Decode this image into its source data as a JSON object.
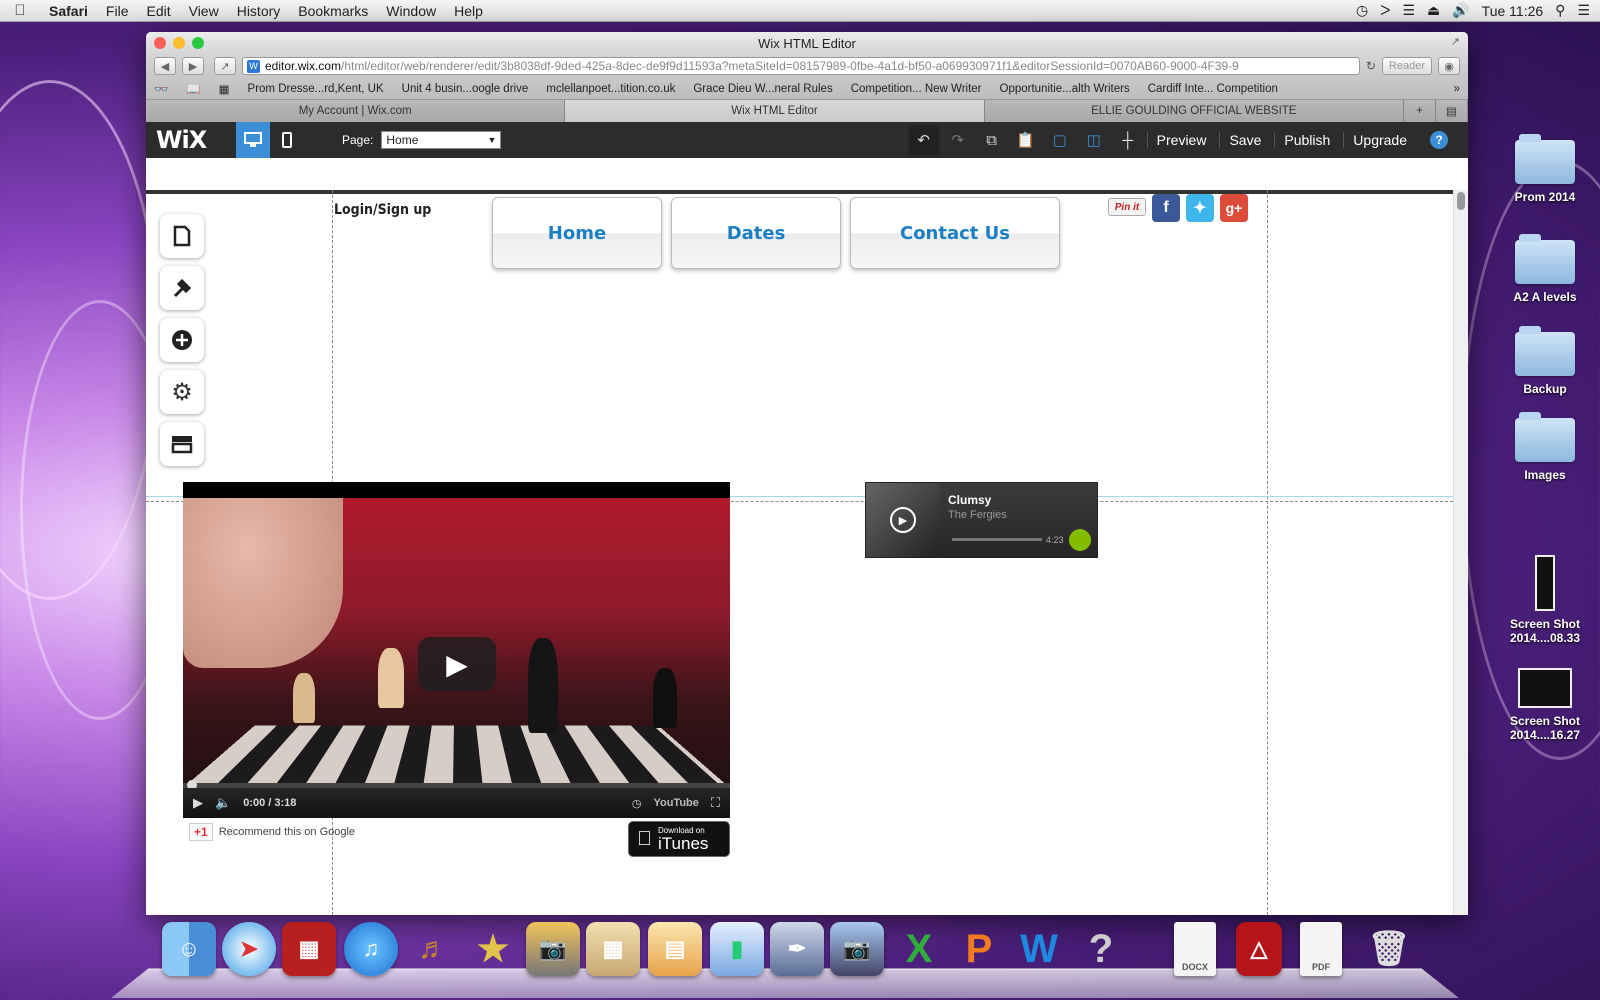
{
  "menubar": {
    "app": "Safari",
    "items": [
      "File",
      "Edit",
      "View",
      "History",
      "Bookmarks",
      "Window",
      "Help"
    ],
    "clock": "Tue 11:26"
  },
  "desktop": {
    "items": [
      {
        "label": "Prom 2014",
        "kind": "folder"
      },
      {
        "label": "A2 A levels",
        "kind": "folder"
      },
      {
        "label": "Backup",
        "kind": "folder"
      },
      {
        "label": "Images",
        "kind": "folder"
      },
      {
        "label": "Screen Shot\n2014....08.33",
        "kind": "screenshot"
      },
      {
        "label": "Screen Shot\n2014....16.27",
        "kind": "screenshot"
      }
    ]
  },
  "browser": {
    "window_title": "Wix HTML Editor",
    "url_host": "editor.wix.com",
    "url_rest": "/html/editor/web/renderer/edit/3b8038df-9ded-425a-8dec-de9f9d11593a?metaSiteId=08157989-0fbe-4a1d-bf50-a069930971f1&editorSessionId=0070AB60-9000-4F39-9",
    "reader_label": "Reader",
    "bookmarks": [
      "Prom Dresse...rd,Kent, UK",
      "Unit 4 busin...oogle drive",
      "mclellanpoet...tition.co.uk",
      "Grace Dieu W...neral Rules",
      "Competition... New Writer",
      "Opportunitie...alth Writers",
      "Cardiff Inte... Competition"
    ],
    "tabs": [
      "My Account | Wix.com",
      "Wix HTML Editor",
      "ELLIE GOULDING OFFICIAL WEBSITE"
    ],
    "active_tab": 1
  },
  "wix": {
    "logo": "WiX",
    "page_label": "Page:",
    "page_value": "Home",
    "actions": [
      "Preview",
      "Save",
      "Publish",
      "Upgrade"
    ],
    "help": "?"
  },
  "site": {
    "login_text": "Login/Sign up",
    "nav": [
      "Home",
      "Dates",
      "Contact Us"
    ],
    "pinit": "Pin it",
    "video": {
      "time": "0:00 / 3:18",
      "brand": "YouTube"
    },
    "gplus_label": "+1",
    "gplus_text": "Recommend this on Google",
    "itunes_small": "Download on",
    "itunes_big": "iTunes",
    "spotify": {
      "title": "Clumsy",
      "artist": "The Fergies",
      "duration": "4:23"
    }
  },
  "dock": {
    "docx_label": "DOCX",
    "pdf_label": "PDF"
  }
}
